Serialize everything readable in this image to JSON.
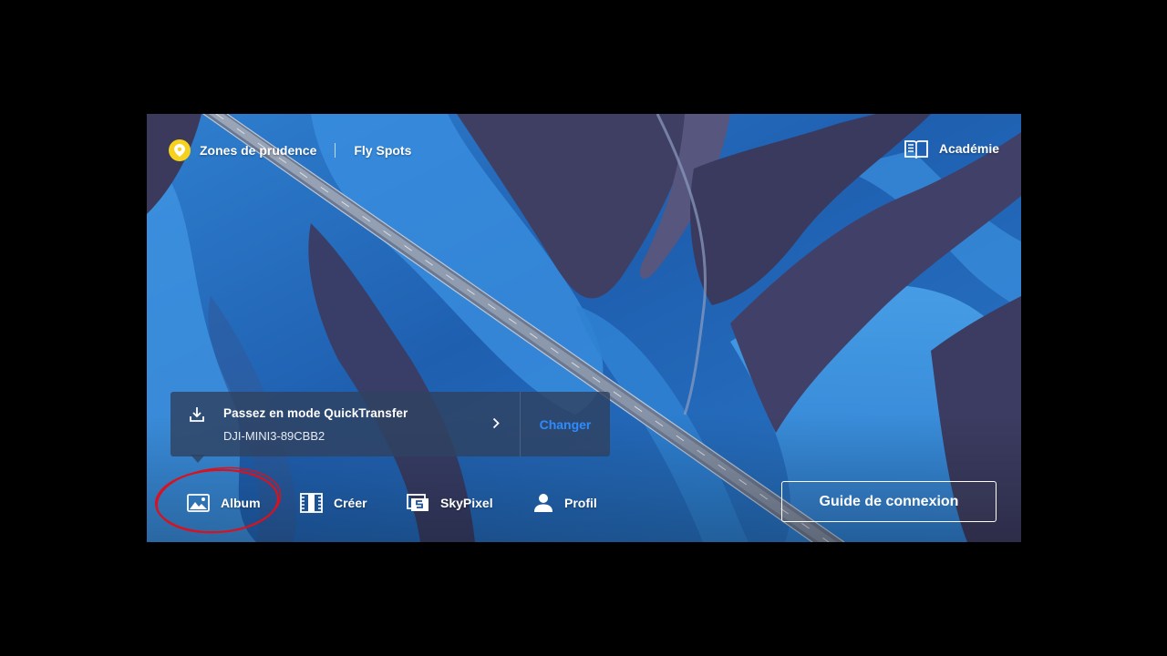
{
  "top_bar": {
    "caution_zones_label": "Zones de prudence",
    "fly_spots_label": "Fly Spots",
    "academy_label": "Académie"
  },
  "quicktransfer": {
    "title": "Passez en mode QuickTransfer",
    "device": "DJI-MINI3-89CBB2",
    "change_label": "Changer"
  },
  "nav": {
    "album": "Album",
    "creer": "Créer",
    "skypixel": "SkyPixel",
    "profil": "Profil"
  },
  "guide_button": "Guide de connexion",
  "icons": {
    "pin": "location-pin-icon",
    "book": "book-icon",
    "download": "download-icon",
    "chevron": "chevron-right-icon",
    "album": "image-icon",
    "creer": "film-icon",
    "skypixel": "skypixel-icon",
    "profil": "user-icon"
  },
  "colors": {
    "accent_yellow": "#f6d21d",
    "link_blue": "#2c8cff",
    "annotation_red": "#d8121f"
  }
}
